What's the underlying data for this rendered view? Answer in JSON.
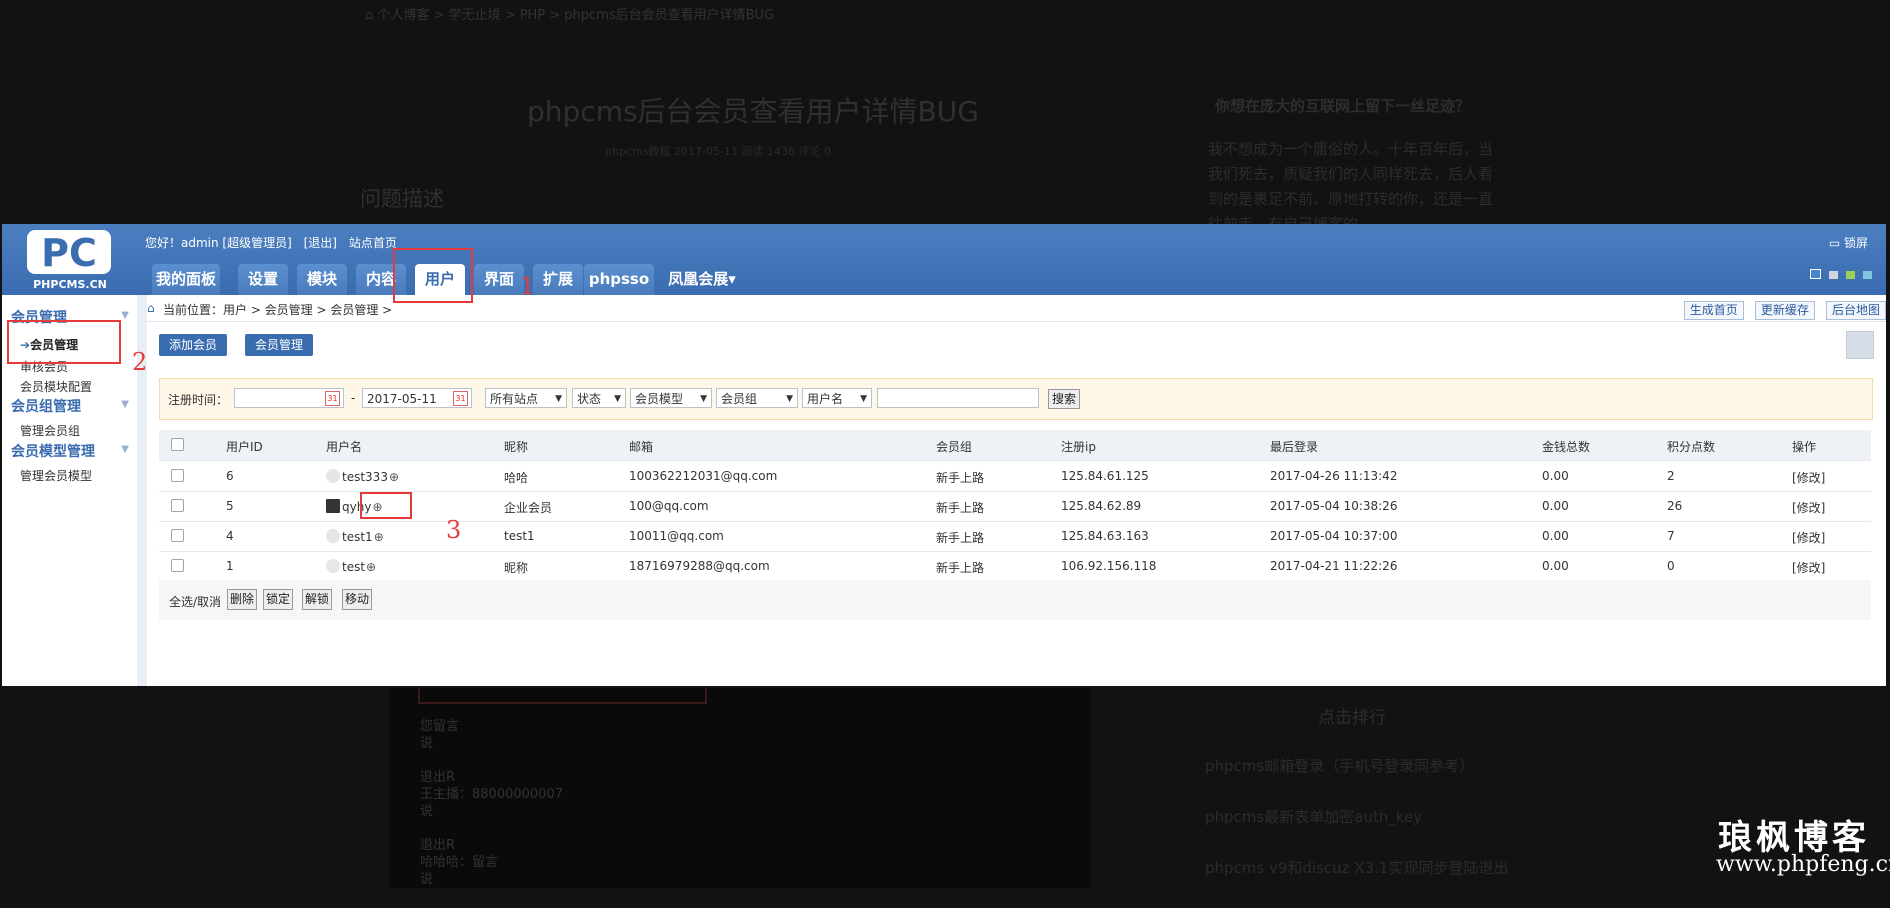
{
  "background_page": {
    "breadcrumb": "⌂ 个人博客 > 学无止境 > PHP > phpcms后台会员查看用户详情BUG",
    "title": "phpcms后台会员查看用户详情BUG",
    "meta": "phpcms教程  2017-05-11  阅读 1436  评论 0",
    "section_heading": "问题描述",
    "side_title": "你想在庞大的互联网上留下一丝足迹？",
    "side_text": "我不想成为一个庸俗的人。十年百年后，当我们死去，质疑我们的人同样死去，后人看到的是裹足不前、原地打转的你，还是一直往前走、有自己博客的...",
    "lower_lines": "您留言\n说\n\n退出R\n王主播：88000000007\n说\n\n退出R\n哈哈哈：留言\n说",
    "rank_title": "点击排行",
    "rank_items": [
      "phpcms邮箱登录（手机号登录同参考）",
      "phpcms最新表单加密auth_key",
      "phpcms v9和discuz X3.1实现同步登陆退出"
    ]
  },
  "watermark": {
    "name": "琅枫博客",
    "url": "www.phpfeng.cn"
  },
  "header": {
    "logo_text": "PC",
    "logo_sub": "PHPCMS.CN",
    "greeting": "您好！admin [超级管理员]",
    "logout": "[退出]",
    "site_home": "站点首页",
    "lock": "锁屏",
    "tabs": [
      "我的面板",
      "设置",
      "模块",
      "内容",
      "用户",
      "界面",
      "扩展",
      "phpsso",
      "凤凰会展▾"
    ],
    "active_tab": "用户"
  },
  "sidebar": {
    "groups": [
      {
        "title": "会员管理",
        "items": [
          "会员管理",
          "审核会员",
          "会员模块配置"
        ]
      },
      {
        "title": "会员组管理",
        "items": [
          "管理会员组"
        ]
      },
      {
        "title": "会员模型管理",
        "items": [
          "管理会员模型"
        ]
      }
    ],
    "active_item": "会员管理"
  },
  "breadcrumb": {
    "text": "当前位置：用户 > 会员管理 > 会员管理 >",
    "tools": [
      "生成首页",
      "更新缓存",
      "后台地图"
    ]
  },
  "subtabs": [
    "添加会员",
    "会员管理"
  ],
  "search": {
    "label": "注册时间：",
    "date_from": "",
    "date_sep": "-",
    "date_to": "2017-05-11",
    "site": "所有站点",
    "status": "状态",
    "model": "会员模型",
    "group": "会员组",
    "field": "用户名",
    "keyword": "",
    "button": "搜索"
  },
  "table": {
    "columns": [
      "用户ID",
      "用户名",
      "昵称",
      "邮箱",
      "会员组",
      "注册ip",
      "最后登录",
      "金钱总数",
      "积分点数",
      "操作"
    ],
    "rows": [
      {
        "id": "6",
        "username": "test333",
        "nickname": "哈哈",
        "email": "100362212031@qq.com",
        "group": "新手上路",
        "ip": "125.84.61.125",
        "last_login": "2017-04-26 11:13:42",
        "money": "0.00",
        "points": "2",
        "action": "[修改]"
      },
      {
        "id": "5",
        "username": "qyhy",
        "nickname": "企业会员",
        "email": "100@qq.com",
        "group": "新手上路",
        "ip": "125.84.62.89",
        "last_login": "2017-05-04 10:38:26",
        "money": "0.00",
        "points": "26",
        "action": "[修改]"
      },
      {
        "id": "4",
        "username": "test1",
        "nickname": "test1",
        "email": "10011@qq.com",
        "group": "新手上路",
        "ip": "125.84.63.163",
        "last_login": "2017-05-04 10:37:00",
        "money": "0.00",
        "points": "7",
        "action": "[修改]"
      },
      {
        "id": "1",
        "username": "test",
        "nickname": "昵称",
        "email": "18716979288@qq.com",
        "group": "新手上路",
        "ip": "106.92.156.118",
        "last_login": "2017-04-21 11:22:26",
        "money": "0.00",
        "points": "0",
        "action": "[修改]"
      }
    ]
  },
  "bulk": {
    "select_all": "全选/取消",
    "buttons": [
      "删除",
      "锁定",
      "解锁",
      "移动"
    ]
  },
  "annotations": [
    "1",
    "2",
    "3"
  ],
  "colors": {
    "header_blue": "#3a6cb0",
    "annotation_red": "#e53b3b",
    "search_bg": "#fff8e8"
  }
}
